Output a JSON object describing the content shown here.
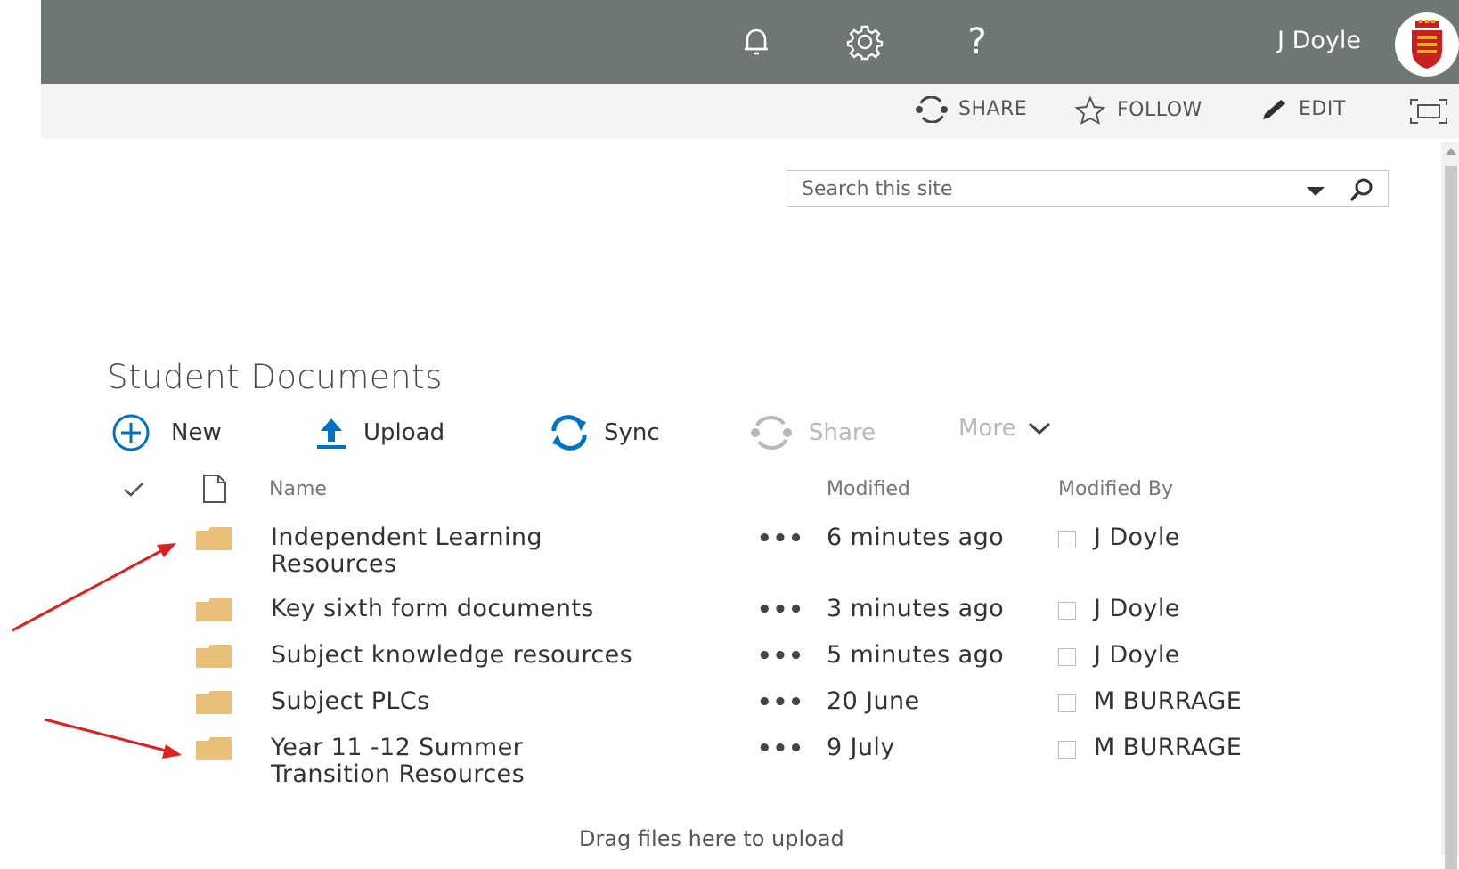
{
  "suite_bar": {
    "user_name": "J Doyle",
    "help_glyph": "?",
    "icons": [
      "bell-icon",
      "gear-icon",
      "help-icon"
    ]
  },
  "page_actions": {
    "share_label": "SHARE",
    "follow_label": "FOLLOW",
    "edit_label": "EDIT"
  },
  "search": {
    "placeholder": "Search this site"
  },
  "library": {
    "title": "Student Documents",
    "commands": {
      "new_label": "New",
      "upload_label": "Upload",
      "sync_label": "Sync",
      "share_label": "Share",
      "more_label": "More"
    },
    "columns": {
      "name": "Name",
      "modified": "Modified",
      "modified_by": "Modified By"
    },
    "rows": [
      {
        "name_line1": "Independent Learning",
        "name_line2": "Resources",
        "modified": "6 minutes ago",
        "modified_by": "J Doyle"
      },
      {
        "name_line1": "Key sixth form documents",
        "name_line2": "",
        "modified": "3 minutes ago",
        "modified_by": "J Doyle"
      },
      {
        "name_line1": "Subject knowledge resources",
        "name_line2": "",
        "modified": "5 minutes ago",
        "modified_by": "J Doyle"
      },
      {
        "name_line1": "Subject PLCs",
        "name_line2": "",
        "modified": "20 June",
        "modified_by": "M BURRAGE"
      },
      {
        "name_line1": "Year 11 -12 Summer",
        "name_line2": "Transition Resources",
        "modified": "9 July",
        "modified_by": "M BURRAGE"
      }
    ],
    "ellipsis": "•••",
    "drag_message": "Drag files here to upload"
  },
  "colors": {
    "suite_bar": "#6e7776",
    "accent": "#0072c6",
    "folder": "#e8c07a",
    "annotation_arrow": "#e02020"
  }
}
